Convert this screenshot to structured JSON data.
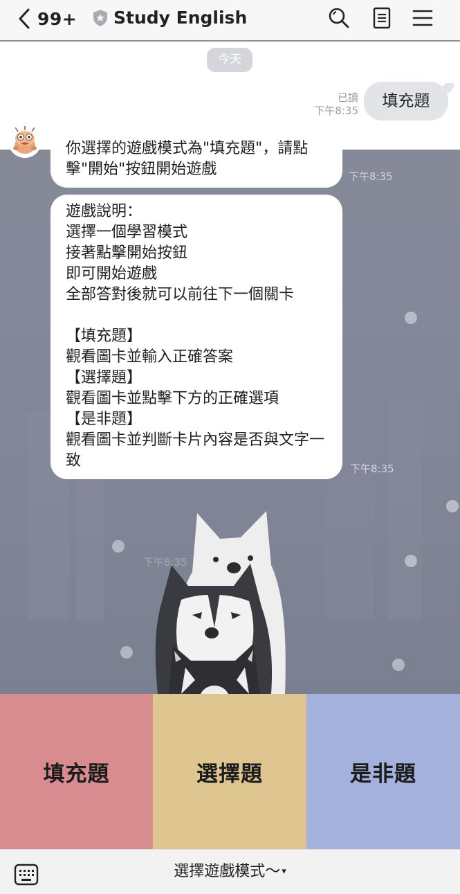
{
  "header": {
    "back_count": "99+",
    "title": "Study English",
    "icons": [
      "chevron-left-icon",
      "shield-icon",
      "search-icon",
      "note-icon",
      "menu-icon"
    ]
  },
  "chat": {
    "date_label": "今天",
    "outgoing": {
      "read_label": "已讀",
      "time": "下午8:35",
      "text": "填充題"
    },
    "incoming": [
      {
        "text": "你選擇的遊戲模式為\"填充題\"，請點擊\"開始\"按鈕開始遊戲",
        "time": "下午8:35"
      },
      {
        "text": "遊戲說明：\n選擇一個學習模式\n接著點擊開始按鈕\n即可開始遊戲\n全部答對後就可以前往下一個關卡\n\n【填充題】\n觀看圖卡並輸入正確答案\n【選擇題】\n觀看圖卡並點擊下方的正確選項\n【是非題】\n觀看圖卡並判斷卡片內容是否與文字一致",
        "time": "下午8:35"
      }
    ],
    "wallpaper_time": "下午8:35"
  },
  "rich_menu": {
    "buttons": [
      {
        "label": "填充題",
        "color": "#d88c8f"
      },
      {
        "label": "選擇題",
        "color": "#dfc691"
      },
      {
        "label": "是非題",
        "color": "#a4b1dc"
      }
    ]
  },
  "bottom_bar": {
    "menu_label": "選擇遊戲模式～",
    "arrow": "▾"
  }
}
